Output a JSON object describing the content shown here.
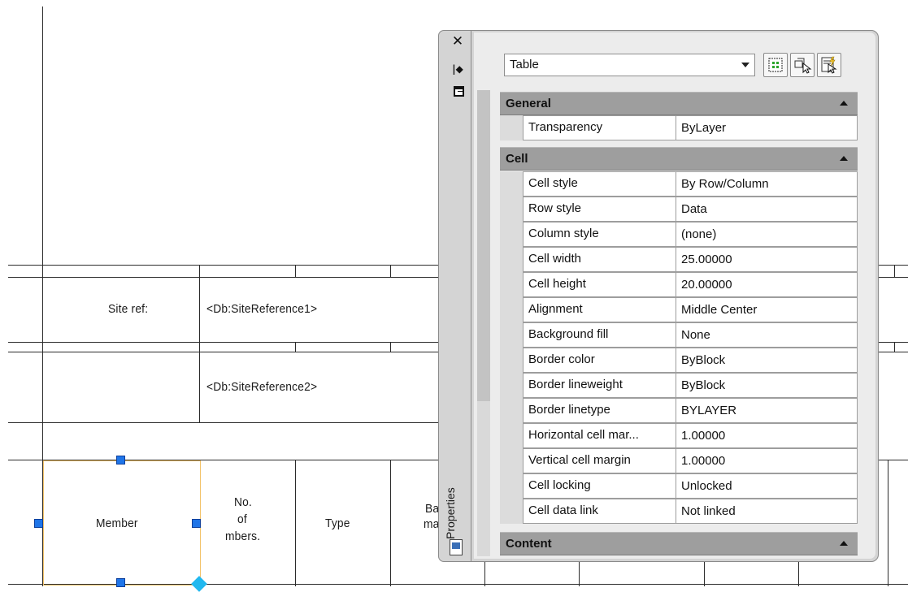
{
  "drawing": {
    "site_ref_label": "Site  ref:",
    "site_reference_1": "<Db:SiteReference1>",
    "site_reference_2": "<Db:SiteReference2>",
    "col_member": "Member",
    "col_no_line1": "No.",
    "col_no_line2": "of",
    "col_no_line3": "mbers.",
    "col_type": "Type",
    "col_partial_line1": "Ba",
    "col_partial_line2": "ma"
  },
  "palette": {
    "title": "Properties",
    "object_type": "Table",
    "strip_icons": [
      "close-icon",
      "auto-hide-icon",
      "palette-menu-icon",
      "palette-properties-icon"
    ],
    "toolbar": [
      "toggle-pickadd-icon",
      "select-objects-icon",
      "quick-select-icon"
    ],
    "sections": [
      {
        "title": "General",
        "rows": [
          {
            "name": "Transparency",
            "value": "ByLayer"
          }
        ]
      },
      {
        "title": "Cell",
        "rows": [
          {
            "name": "Cell style",
            "value": "By Row/Column"
          },
          {
            "name": "Row style",
            "value": "Data"
          },
          {
            "name": "Column style",
            "value": "(none)"
          },
          {
            "name": "Cell width",
            "value": "25.00000"
          },
          {
            "name": "Cell height",
            "value": "20.00000"
          },
          {
            "name": "Alignment",
            "value": "Middle Center"
          },
          {
            "name": "Background fill",
            "value": "None"
          },
          {
            "name": "Border color",
            "value": "ByBlock"
          },
          {
            "name": "Border lineweight",
            "value": "ByBlock"
          },
          {
            "name": "Border linetype",
            "value": "BYLAYER"
          },
          {
            "name": "Horizontal cell mar...",
            "value": "1.00000"
          },
          {
            "name": "Vertical cell margin",
            "value": "1.00000"
          },
          {
            "name": "Cell locking",
            "value": "Unlocked"
          },
          {
            "name": "Cell data link",
            "value": "Not linked"
          }
        ]
      },
      {
        "title": "Content",
        "rows": []
      }
    ]
  }
}
